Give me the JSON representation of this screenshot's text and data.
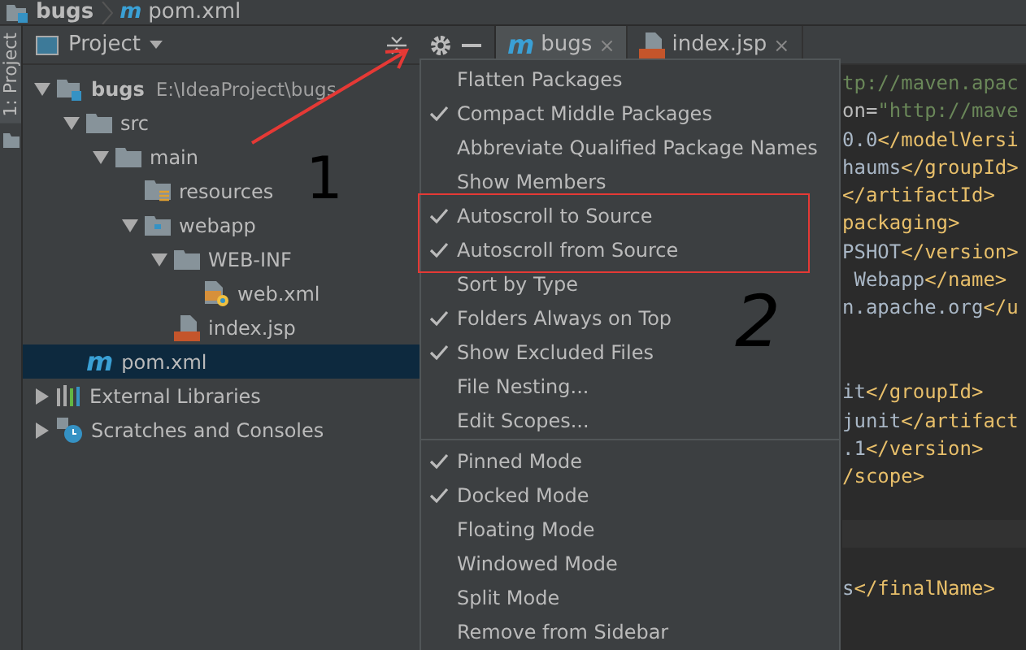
{
  "breadcrumbs": [
    {
      "kind": "module",
      "label": "bugs"
    },
    {
      "kind": "maven",
      "icon_text": "m",
      "label": "pom.xml"
    }
  ],
  "side_strip": {
    "tabs": [
      {
        "label": "1: Project",
        "selected": true
      }
    ]
  },
  "project_panel": {
    "title": "Project",
    "tree": [
      {
        "kind": "module",
        "label": "bugs",
        "path": "E:\\IdeaProject\\bugs",
        "expanded": true,
        "selected": false,
        "children": [
          {
            "kind": "folder",
            "label": "src",
            "expanded": true,
            "selected": false,
            "children": [
              {
                "kind": "folder",
                "label": "main",
                "expanded": true,
                "selected": false,
                "children": [
                  {
                    "kind": "resources",
                    "label": "resources",
                    "selected": false
                  },
                  {
                    "kind": "web",
                    "label": "webapp",
                    "expanded": true,
                    "selected": false,
                    "children": [
                      {
                        "kind": "folder",
                        "label": "WEB-INF",
                        "expanded": true,
                        "selected": false,
                        "children": [
                          {
                            "kind": "xml",
                            "label": "web.xml",
                            "selected": false
                          }
                        ]
                      },
                      {
                        "kind": "jsp",
                        "label": "index.jsp",
                        "selected": false
                      }
                    ]
                  }
                ]
              }
            ]
          },
          {
            "kind": "maven",
            "icon_text": "m",
            "label": "pom.xml",
            "selected": true
          }
        ]
      },
      {
        "kind": "libraries",
        "label": "External Libraries",
        "expanded": false,
        "selected": false
      },
      {
        "kind": "scratches",
        "label": "Scratches and Consoles",
        "expanded": false,
        "selected": false
      }
    ]
  },
  "editor_tabs": [
    {
      "kind": "maven",
      "icon_text": "m",
      "label": "bugs",
      "selected": true,
      "close": "×"
    },
    {
      "kind": "jsp",
      "label": "index.jsp",
      "selected": false,
      "close": "×"
    }
  ],
  "code_lines": [
    {
      "kind": "code",
      "parts": [
        {
          "kind": "string",
          "text": "tp://maven.apac"
        }
      ]
    },
    {
      "kind": "code",
      "parts": [
        {
          "kind": "attr",
          "text": "on="
        },
        {
          "kind": "string",
          "text": "\"http://mave"
        }
      ]
    },
    {
      "kind": "code",
      "parts": [
        {
          "kind": "text",
          "text": "0.0"
        },
        {
          "kind": "tag",
          "text": "</modelVersi"
        }
      ]
    },
    {
      "kind": "code",
      "parts": [
        {
          "kind": "text",
          "text": "haums"
        },
        {
          "kind": "tag",
          "text": "</groupId>"
        }
      ]
    },
    {
      "kind": "code",
      "parts": [
        {
          "kind": "tag",
          "text": "</artifactId>"
        }
      ]
    },
    {
      "kind": "code",
      "parts": [
        {
          "kind": "tag",
          "text": "packaging>"
        }
      ]
    },
    {
      "kind": "code",
      "parts": [
        {
          "kind": "text",
          "text": "PSHOT"
        },
        {
          "kind": "tag",
          "text": "</version>"
        }
      ]
    },
    {
      "kind": "code",
      "parts": [
        {
          "kind": "text",
          "text": " Webapp"
        },
        {
          "kind": "tag",
          "text": "</name>"
        }
      ]
    },
    {
      "kind": "code",
      "parts": [
        {
          "kind": "text",
          "text": "n.apache.org"
        },
        {
          "kind": "tag",
          "text": "</u"
        }
      ]
    },
    {
      "kind": "blank"
    },
    {
      "kind": "blank"
    },
    {
      "kind": "code",
      "parts": [
        {
          "kind": "text",
          "text": "it"
        },
        {
          "kind": "tag",
          "text": "</groupId>"
        }
      ]
    },
    {
      "kind": "code",
      "parts": [
        {
          "kind": "text",
          "text": "junit"
        },
        {
          "kind": "tag",
          "text": "</artifact"
        }
      ]
    },
    {
      "kind": "code",
      "parts": [
        {
          "kind": "text",
          "text": ".1"
        },
        {
          "kind": "tag",
          "text": "</version>"
        }
      ]
    },
    {
      "kind": "code",
      "parts": [
        {
          "kind": "tag",
          "text": "/scope>"
        }
      ]
    },
    {
      "kind": "blank"
    },
    {
      "kind": "current"
    },
    {
      "kind": "blank"
    },
    {
      "kind": "code",
      "parts": [
        {
          "kind": "text",
          "text": "s"
        },
        {
          "kind": "tag",
          "text": "</finalName>"
        }
      ]
    }
  ],
  "menu": [
    {
      "label": "Flatten Packages",
      "checked": false
    },
    {
      "label": "Compact Middle Packages",
      "checked": true
    },
    {
      "label": "Abbreviate Qualified Package Names",
      "checked": false
    },
    {
      "label": "Show Members",
      "checked": false
    },
    {
      "label": "Autoscroll to Source",
      "checked": true
    },
    {
      "label": "Autoscroll from Source",
      "checked": true
    },
    {
      "label": "Sort by Type",
      "checked": false
    },
    {
      "label": "Folders Always on Top",
      "checked": true
    },
    {
      "label": "Show Excluded Files",
      "checked": true
    },
    {
      "label": "File Nesting...",
      "checked": false
    },
    {
      "label": "Edit Scopes...",
      "checked": false
    },
    {
      "label": "Pinned Mode",
      "checked": true,
      "separator_before": true
    },
    {
      "label": "Docked Mode",
      "checked": true
    },
    {
      "label": "Floating Mode",
      "checked": false
    },
    {
      "label": "Windowed Mode",
      "checked": false
    },
    {
      "label": "Split Mode",
      "checked": false
    },
    {
      "label": "Remove from Sidebar",
      "checked": false
    }
  ],
  "handwritten_marks": [
    "1",
    "2"
  ]
}
